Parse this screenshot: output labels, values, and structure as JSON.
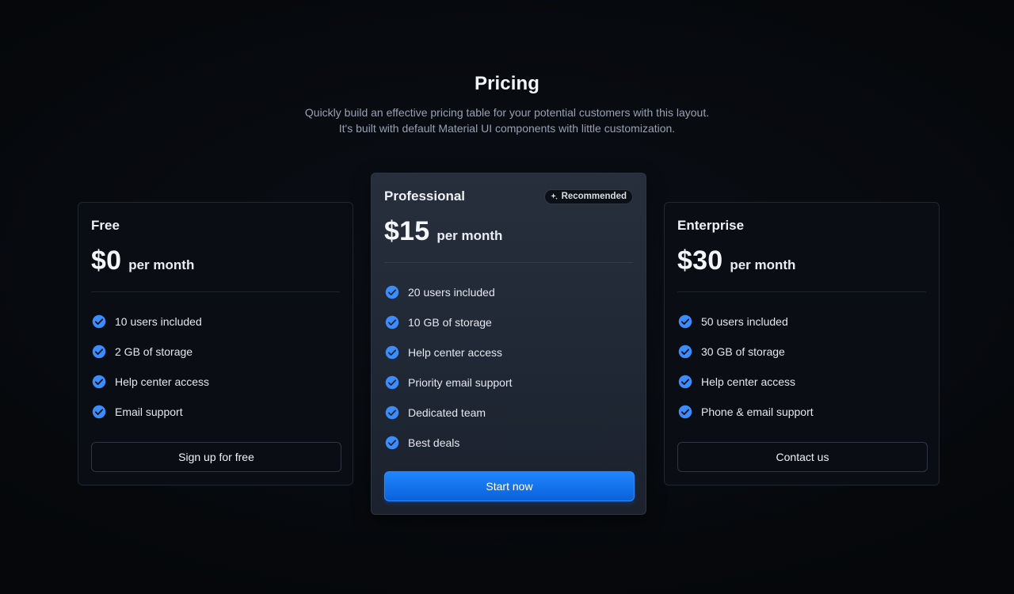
{
  "header": {
    "title": "Pricing",
    "subtitle_line1": "Quickly build an effective pricing table for your potential customers with this layout.",
    "subtitle_line2": "It's built with default Material UI components with little customization."
  },
  "colors": {
    "accent": "#1976ff",
    "check": "#3b8cff",
    "background": "#05070a"
  },
  "plans": [
    {
      "name": "Free",
      "price": "$0",
      "period": "per month",
      "features": [
        "10 users included",
        "2 GB of storage",
        "Help center access",
        "Email support"
      ],
      "button": "Sign up for free"
    },
    {
      "name": "Professional",
      "badge": "Recommended",
      "badge_icon": "sparkle-icon",
      "price": "$15",
      "period": "per month",
      "features": [
        "20 users included",
        "10 GB of storage",
        "Help center access",
        "Priority email support",
        "Dedicated team",
        "Best deals"
      ],
      "button": "Start now"
    },
    {
      "name": "Enterprise",
      "price": "$30",
      "period": "per month",
      "features": [
        "50 users included",
        "30 GB of storage",
        "Help center access",
        "Phone & email support"
      ],
      "button": "Contact us"
    }
  ],
  "icons": {
    "feature": "check-circle-icon"
  }
}
